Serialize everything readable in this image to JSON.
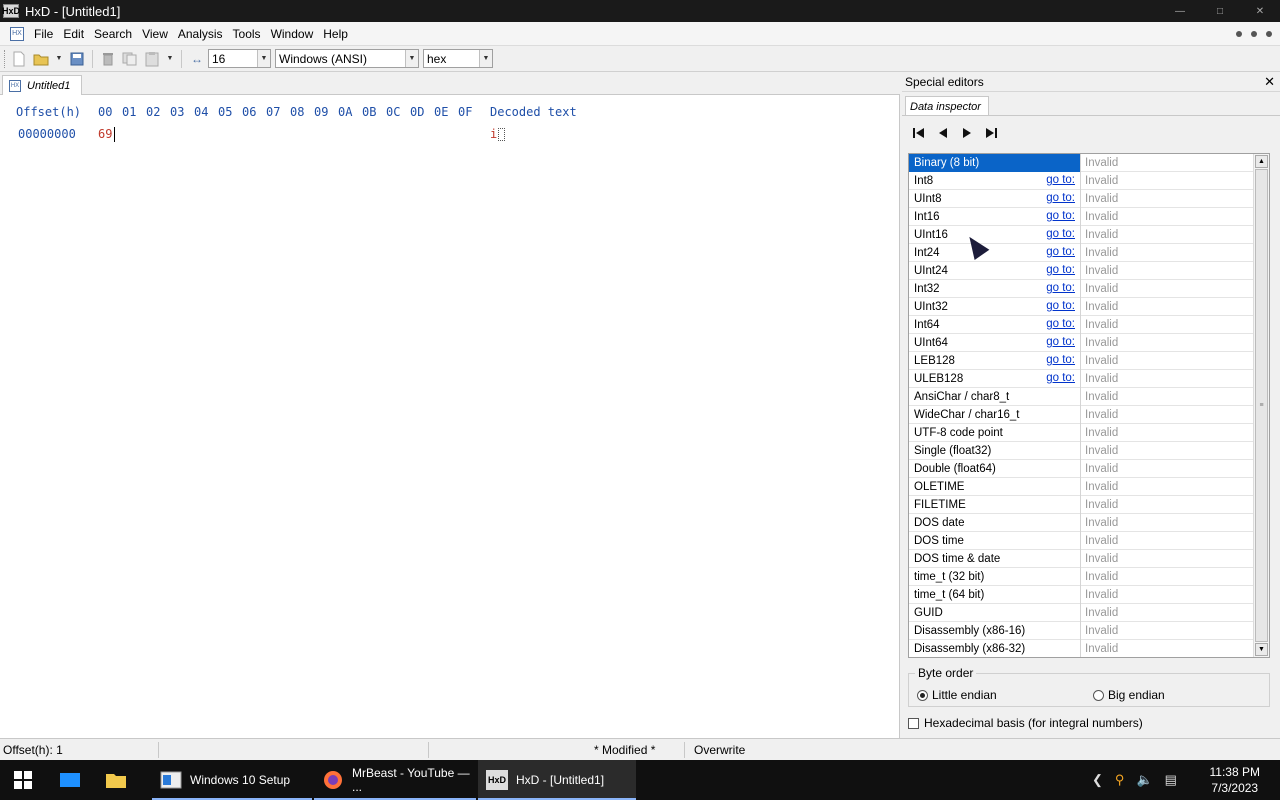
{
  "window": {
    "title": "HxD - [Untitled1]",
    "app_icon": "HxD"
  },
  "menu": [
    "File",
    "Edit",
    "Search",
    "View",
    "Analysis",
    "Tools",
    "Window",
    "Help"
  ],
  "toolbar": {
    "bytes_per_row": "16",
    "charset": "Windows (ANSI)",
    "base": "hex"
  },
  "editor": {
    "tab_label": "Untitled1",
    "header": {
      "offset_label": "Offset(h)",
      "columns": [
        "00",
        "01",
        "02",
        "03",
        "04",
        "05",
        "06",
        "07",
        "08",
        "09",
        "0A",
        "0B",
        "0C",
        "0D",
        "0E",
        "0F"
      ],
      "decoded_label": "Decoded text"
    },
    "row": {
      "offset": "00000000",
      "byte": "69",
      "decoded": "i"
    }
  },
  "special_editors": {
    "title": "Special editors",
    "close": "✕",
    "tab_label": "Data inspector",
    "rows": [
      {
        "name": "Binary (8 bit)",
        "goto": "",
        "value": "Invalid",
        "selected": true
      },
      {
        "name": "Int8",
        "goto": "go to:",
        "value": "Invalid"
      },
      {
        "name": "UInt8",
        "goto": "go to:",
        "value": "Invalid"
      },
      {
        "name": "Int16",
        "goto": "go to:",
        "value": "Invalid"
      },
      {
        "name": "UInt16",
        "goto": "go to:",
        "value": "Invalid"
      },
      {
        "name": "Int24",
        "goto": "go to:",
        "value": "Invalid"
      },
      {
        "name": "UInt24",
        "goto": "go to:",
        "value": "Invalid"
      },
      {
        "name": "Int32",
        "goto": "go to:",
        "value": "Invalid"
      },
      {
        "name": "UInt32",
        "goto": "go to:",
        "value": "Invalid"
      },
      {
        "name": "Int64",
        "goto": "go to:",
        "value": "Invalid"
      },
      {
        "name": "UInt64",
        "goto": "go to:",
        "value": "Invalid"
      },
      {
        "name": "LEB128",
        "goto": "go to:",
        "value": "Invalid"
      },
      {
        "name": "ULEB128",
        "goto": "go to:",
        "value": "Invalid"
      },
      {
        "name": "AnsiChar / char8_t",
        "goto": "",
        "value": "Invalid"
      },
      {
        "name": "WideChar / char16_t",
        "goto": "",
        "value": "Invalid"
      },
      {
        "name": "UTF-8 code point",
        "goto": "",
        "value": "Invalid"
      },
      {
        "name": "Single (float32)",
        "goto": "",
        "value": "Invalid"
      },
      {
        "name": "Double (float64)",
        "goto": "",
        "value": "Invalid"
      },
      {
        "name": "OLETIME",
        "goto": "",
        "value": "Invalid"
      },
      {
        "name": "FILETIME",
        "goto": "",
        "value": "Invalid"
      },
      {
        "name": "DOS date",
        "goto": "",
        "value": "Invalid"
      },
      {
        "name": "DOS time",
        "goto": "",
        "value": "Invalid"
      },
      {
        "name": "DOS time & date",
        "goto": "",
        "value": "Invalid"
      },
      {
        "name": "time_t (32 bit)",
        "goto": "",
        "value": "Invalid"
      },
      {
        "name": "time_t (64 bit)",
        "goto": "",
        "value": "Invalid"
      },
      {
        "name": "GUID",
        "goto": "",
        "value": "Invalid"
      },
      {
        "name": "Disassembly (x86-16)",
        "goto": "",
        "value": "Invalid"
      },
      {
        "name": "Disassembly (x86-32)",
        "goto": "",
        "value": "Invalid"
      }
    ],
    "byte_order": {
      "legend": "Byte order",
      "little": "Little endian",
      "big": "Big endian",
      "selected": "little"
    },
    "hex_basis": "Hexadecimal basis (for integral numbers)"
  },
  "status": {
    "offset": "Offset(h): 1",
    "modified": "* Modified *",
    "mode": "Overwrite"
  },
  "taskbar": {
    "apps": [
      {
        "label": "Windows 10 Setup",
        "active": false
      },
      {
        "label": "MrBeast - YouTube — ...",
        "active": false
      },
      {
        "label": "HxD - [Untitled1]",
        "active": true
      }
    ],
    "time": "11:38 PM",
    "date": "7/3/2023"
  },
  "colors": {
    "accent": "#0a64c8",
    "hex_header": "#1f4fa8",
    "byte_red": "#c0392b",
    "link": "#0033cc"
  }
}
